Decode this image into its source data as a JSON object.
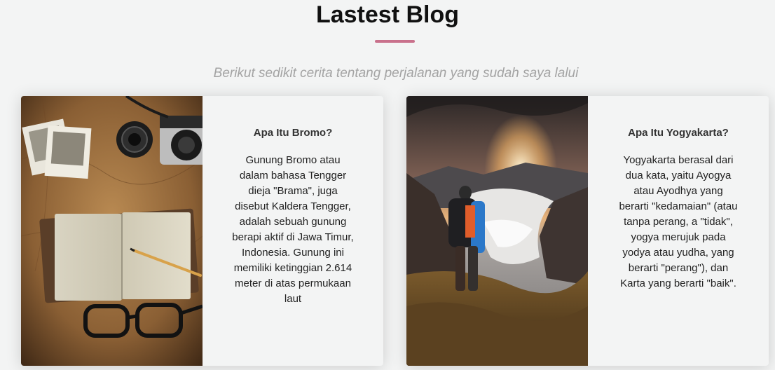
{
  "section": {
    "title": "Lastest Blog",
    "accent_color": "#c9718c",
    "subtitle": "Berikut sedikit cerita tentang perjalanan yang sudah saya lalui"
  },
  "cards": [
    {
      "image": "photo: travel map, vintage camera, open notebook, pencil, eyeglasses",
      "heading": "Apa Itu Bromo?",
      "text": "Gunung Bromo atau dalam bahasa Tengger dieja \"Brama\", juga disebut Kaldera Tengger, adalah sebuah gunung berapi aktif di Jawa Timur, Indonesia. Gunung ini memiliki ketinggian 2.614 meter di atas permukaan laut"
    },
    {
      "image": "photo: hiker with backpack on mountain ridge at sunrise above sea of clouds",
      "heading": "Apa Itu Yogyakarta?",
      "text": "Yogyakarta berasal dari dua kata, yaitu Ayogya atau Ayodhya yang berarti \"kedamaian\" (atau tanpa perang, a \"tidak\", yogya merujuk pada yodya atau yudha, yang berarti \"perang\"), dan Karta yang berarti \"baik\"."
    }
  ]
}
